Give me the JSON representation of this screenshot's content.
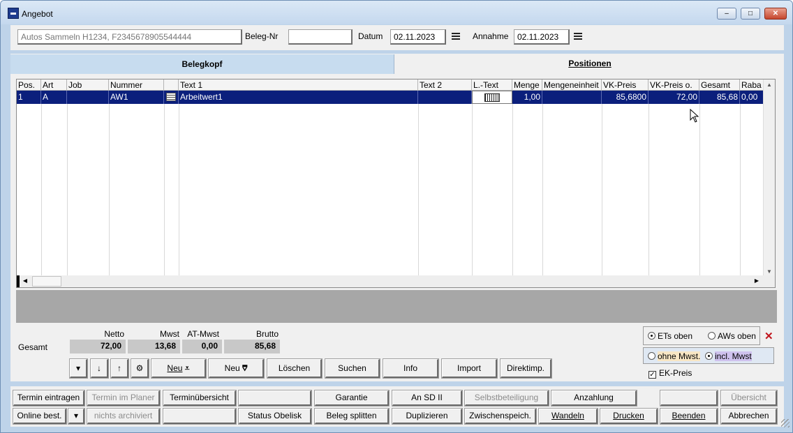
{
  "window": {
    "title": "Angebot",
    "min": "–",
    "max": "□",
    "close": "✕"
  },
  "header": {
    "customer": "Autos Sammeln H1234, F2345678905544444",
    "beleg_label": "Beleg-Nr",
    "beleg_value": "",
    "datum_label": "Datum",
    "datum_value": "02.11.2023",
    "annahme_label": "Annahme",
    "annahme_value": "02.11.2023"
  },
  "tabs": [
    {
      "label": "Belegkopf",
      "active": false
    },
    {
      "label": "Positionen",
      "active": true
    }
  ],
  "grid": {
    "columns": [
      "Pos.",
      "Art",
      "Job",
      "Nummer",
      "",
      "Text 1",
      "Text 2",
      "L.-Text",
      "Menge",
      "Mengeneinheit",
      "VK-Preis",
      "VK-Preis o.",
      "Gesamt",
      "Raba"
    ],
    "rows": [
      {
        "pos": "1",
        "art": "A",
        "job": "",
        "nummer": "AW1",
        "text1": "Arbeitwert1",
        "text2": "",
        "menge": "1,00",
        "einheit": "",
        "vk": "85,6800",
        "vk_o": "72,00",
        "gesamt": "85,68",
        "rabatt": "0,00"
      }
    ]
  },
  "totals": {
    "label": "Gesamt",
    "netto_label": "Netto",
    "netto": "72,00",
    "mwst_label": "Mwst",
    "mwst": "13,68",
    "at_label": "AT-Mwst",
    "at": "0,00",
    "brutto_label": "Brutto",
    "brutto": "85,68"
  },
  "toolbar": {
    "neu1": "Neu",
    "neu2": "Neu",
    "loeschen": "Löschen",
    "suchen": "Suchen",
    "info": "Info",
    "import": "Import",
    "direktimp": "Direktimp."
  },
  "options": {
    "ets_oben": "ETs oben",
    "aws_oben": "AWs oben",
    "ohne_mwst": "ohne Mwst.",
    "incl_mwst": "incl. Mwst",
    "ek_preis": "EK-Preis"
  },
  "bottom": {
    "row1": [
      "Termin eintragen",
      "Termin im Planer",
      "Terminübersicht",
      "",
      "Garantie",
      "An SD II",
      "Selbstbeteiligung",
      "Anzahlung",
      "",
      "Übersicht"
    ],
    "row2": [
      "Online best.",
      "nichts archiviert",
      "",
      "Status Obelisk",
      "Beleg splitten",
      "Duplizieren",
      "Zwischenspeich.",
      "Wandeln",
      "Drucken",
      "Beenden",
      "Abbrechen"
    ]
  },
  "colors": {
    "selection": "#0b1f7c",
    "window_bg": "#bed3e9",
    "close_btn": "#c5462d"
  }
}
